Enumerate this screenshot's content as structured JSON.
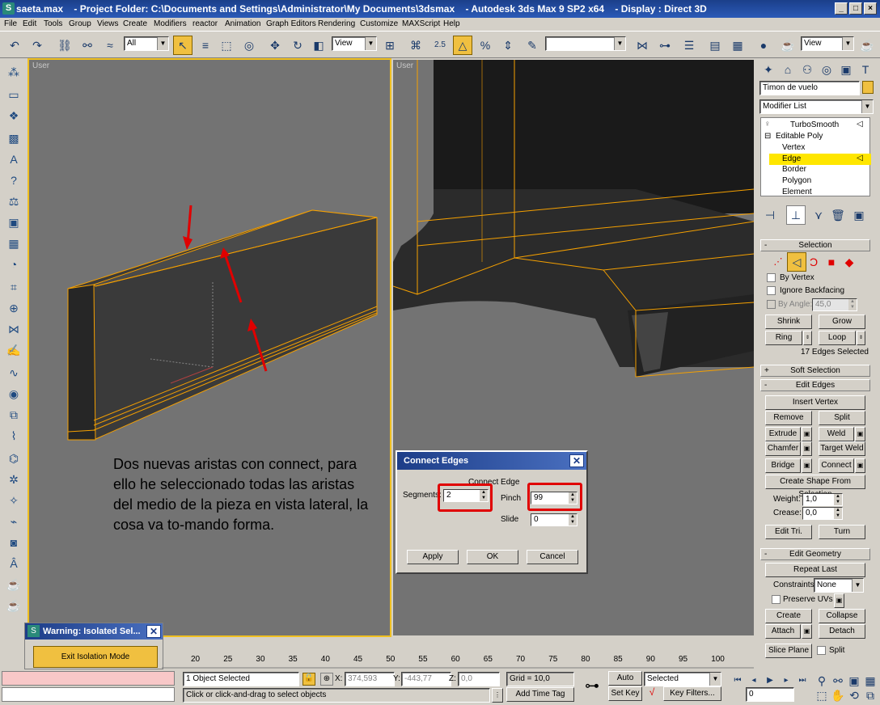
{
  "title": "saeta.max    - Project Folder: C:\\Documents and Settings\\Administrator\\My Documents\\3dsmax    - Autodesk 3ds Max 9 SP2 x64    - Display : Direct 3D",
  "menu": [
    "File",
    "Edit",
    "Tools",
    "Group",
    "Views",
    "Create",
    "Modifiers",
    "reactor",
    "Animation",
    "Graph Editors",
    "Rendering",
    "Customize",
    "MAXScript",
    "Help"
  ],
  "toolbar": {
    "selection_filter": "All",
    "ref_coord": "View",
    "named_sel": "",
    "view_combo": "View",
    "snap_label": "2.5"
  },
  "viewports": {
    "left_label": "User",
    "right_label": "User"
  },
  "note": {
    "text": "Dos nuevas aristas con connect, para ello he seleccionado todas las aristas del medio de la pieza en vista lateral, la cosa va to-mando forma."
  },
  "dialog": {
    "title": "Connect Edges",
    "group": "Connect Edge",
    "segments_label": "Segments:",
    "segments": "2",
    "pinch_label": "Pinch",
    "pinch": "99",
    "slide_label": "Slide",
    "slide": "0",
    "apply": "Apply",
    "ok": "OK",
    "cancel": "Cancel"
  },
  "command_panel": {
    "object_name": "Timon de vuelo",
    "modifier_list": "Modifier List",
    "stack": [
      "TurboSmooth",
      "Editable Poly",
      "Vertex",
      "Edge",
      "Border",
      "Polygon",
      "Element"
    ],
    "selection": {
      "header": "Selection",
      "by_vertex": "By Vertex",
      "ignore_backfacing": "Ignore Backfacing",
      "by_angle": "By Angle:",
      "angle": "45,0",
      "shrink": "Shrink",
      "grow": "Grow",
      "ring": "Ring",
      "loop": "Loop",
      "status": "17 Edges Selected"
    },
    "soft_selection": "Soft Selection",
    "edit_edges": {
      "header": "Edit Edges",
      "insert_vertex": "Insert Vertex",
      "remove": "Remove",
      "split": "Split",
      "extrude": "Extrude",
      "weld": "Weld",
      "chamfer": "Chamfer",
      "target_weld": "Target Weld",
      "bridge": "Bridge",
      "connect": "Connect",
      "create_shape": "Create Shape From Selection",
      "weight_label": "Weight:",
      "weight": "1,0",
      "crease_label": "Crease:",
      "crease": "0,0",
      "edit_tri": "Edit Tri.",
      "turn": "Turn"
    },
    "edit_geometry": {
      "header": "Edit Geometry",
      "repeat_last": "Repeat Last",
      "constraints_label": "Constraints:",
      "constraints": "None",
      "preserve_uvs": "Preserve UVs",
      "create": "Create",
      "collapse": "Collapse",
      "attach": "Attach",
      "detach": "Detach",
      "slice_plane": "Slice Plane",
      "split": "Split"
    }
  },
  "warning": {
    "title": "Warning: Isolated Sel...",
    "button": "Exit Isolation Mode"
  },
  "timeline": {
    "ticks": [
      "20",
      "25",
      "30",
      "35",
      "40",
      "45",
      "50",
      "55",
      "60",
      "65",
      "70",
      "75",
      "80",
      "85",
      "90",
      "95",
      "100"
    ]
  },
  "status": {
    "selected": "1 Object Selected",
    "x_label": "X:",
    "x": "374,593",
    "y_label": "Y:",
    "y": "-443,77",
    "z_label": "Z:",
    "z": "0,0",
    "grid": "Grid = 10,0",
    "auto_key": "Auto Key",
    "key_mode": "Selected",
    "set_key": "Set Key",
    "key_filters": "Key Filters...",
    "prompt": "Click or click-and-drag to select objects",
    "add_time_tag": "Add Time Tag",
    "frame": "0"
  },
  "colors": {
    "viewport_bg": "#737373",
    "active_border": "#f0c020",
    "selection_orange": "#f5a000",
    "annotation_red": "#e00000"
  }
}
